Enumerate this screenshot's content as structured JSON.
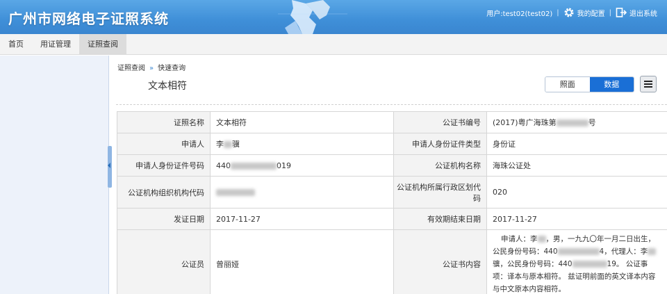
{
  "header": {
    "title": "广州市网络电子证照系统",
    "user_label": "用户:test02(test02)",
    "config_label": "我的配置",
    "logout_label": "退出系统",
    "colors": {
      "bar": "#3f8fd8",
      "accent": "#1a6fd6"
    }
  },
  "nav": {
    "tabs": [
      {
        "label": "首页"
      },
      {
        "label": "用证管理"
      },
      {
        "label": "证照查阅"
      }
    ],
    "active": "证照查阅"
  },
  "breadcrumb": {
    "parent": "证照查阅",
    "current": "快速查询"
  },
  "page_title": "文本相符",
  "toggle": {
    "view_label": "照面",
    "data_label": "数据"
  },
  "rows": [
    {
      "label1": "证照名称",
      "value1": "文本相符",
      "label2": "公证书编号",
      "value2": "(2017)粤广海珠第",
      "value2_tail": "号"
    },
    {
      "label1": "申请人",
      "value1_a": "李",
      "value1_b": "骥",
      "label2": "申请人身份证件类型",
      "value2": "身份证"
    },
    {
      "label1": "申请人身份证件号码",
      "value1_a": "440",
      "value1_b": "019",
      "label2": "公证机构名称",
      "value2": "海珠公证处"
    },
    {
      "label1": "公证机构组织机构代码",
      "value1": "",
      "label2": "公证机构所属行政区划代码",
      "value2": "020"
    },
    {
      "label1": "发证日期",
      "value1": "2017-11-27",
      "label2": "有效期结束日期",
      "value2": "2017-11-27"
    },
    {
      "label1": "公证员",
      "value1": "曾丽娅",
      "label2": "公证书内容",
      "content_1": "申请人：李",
      "content_2": "，男，一九九〇年一月二日出生，公民身份号码：440",
      "content_3": "4，代理人：李",
      "content_4": "骥，公民身份号码：440",
      "content_5": "19。 公证事项：译本与原本相符。 兹证明前面的英文译本内容与中文原本内容相符。"
    }
  ]
}
